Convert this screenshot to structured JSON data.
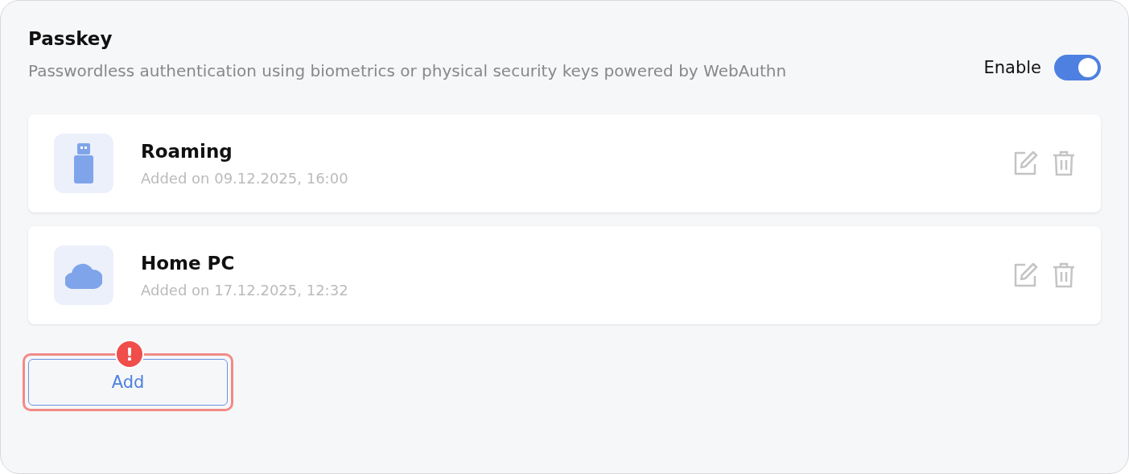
{
  "section": {
    "title": "Passkey",
    "description": "Passwordless authentication using biometrics or physical security keys powered by WebAuthn",
    "toggle": {
      "label": "Enable",
      "on": true
    }
  },
  "keys": [
    {
      "kind": "usb",
      "name": "Roaming",
      "added": "Added on 09.12.2025, 16:00"
    },
    {
      "kind": "cloud",
      "name": "Home PC",
      "added": "Added on 17.12.2025, 12:32"
    }
  ],
  "add_button": {
    "label": "Add",
    "flagged": true,
    "alert_mark": "!"
  }
}
